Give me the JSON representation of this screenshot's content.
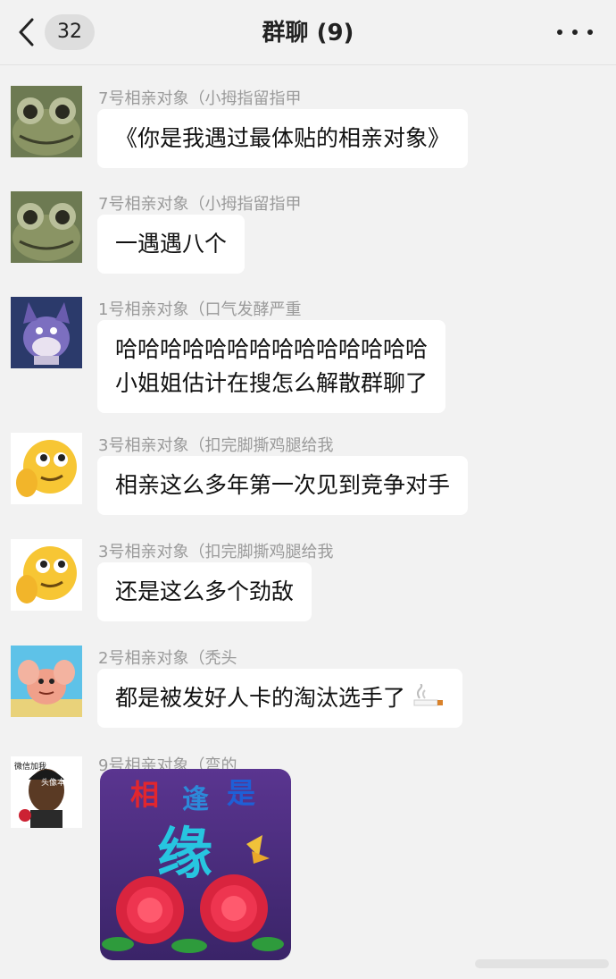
{
  "header": {
    "unread_count": "32",
    "title": "群聊 (9)",
    "back_icon": "chevron-left-icon",
    "more_icon": "more-dots-icon"
  },
  "messages": [
    {
      "sender": "7号相亲对象（小拇指留指甲",
      "lines": [
        "《你是我遇过最体贴的相亲对象》"
      ],
      "avatar": "frog-avatar"
    },
    {
      "sender": "7号相亲对象（小拇指留指甲",
      "lines": [
        "一遇遇八个"
      ],
      "avatar": "frog-avatar"
    },
    {
      "sender": "1号相亲对象（口气发酵严重",
      "lines": [
        "哈哈哈哈哈哈哈哈哈哈哈哈哈哈",
        "小姐姐估计在搜怎么解散群聊了"
      ],
      "avatar": "cat-avatar"
    },
    {
      "sender": "3号相亲对象（扣完脚撕鸡腿给我",
      "lines": [
        "相亲这么多年第一次见到竞争对手"
      ],
      "avatar": "emoji-avatar"
    },
    {
      "sender": "3号相亲对象（扣完脚撕鸡腿给我",
      "lines": [
        "还是这么多个劲敌"
      ],
      "avatar": "emoji-avatar"
    },
    {
      "sender": "2号相亲对象（秃头",
      "lines": [
        "都是被发好人卡的淘汰选手了"
      ],
      "avatar": "starfish-avatar",
      "trailing_emoji": "cigarette-icon"
    },
    {
      "sender": "9号相亲对象（弯的",
      "sticker": {
        "text_top": [
          "相",
          "逢",
          "是"
        ],
        "text_big": "缘"
      },
      "avatar": "man-avatar",
      "avatar_caption_1": "微信加我",
      "avatar_caption_2": "头像本人"
    }
  ],
  "colors": {
    "background": "#f2f2f2",
    "bubble": "#ffffff",
    "sender_text": "#9a9a9a",
    "sticker_bg": "#4b2c7e"
  }
}
